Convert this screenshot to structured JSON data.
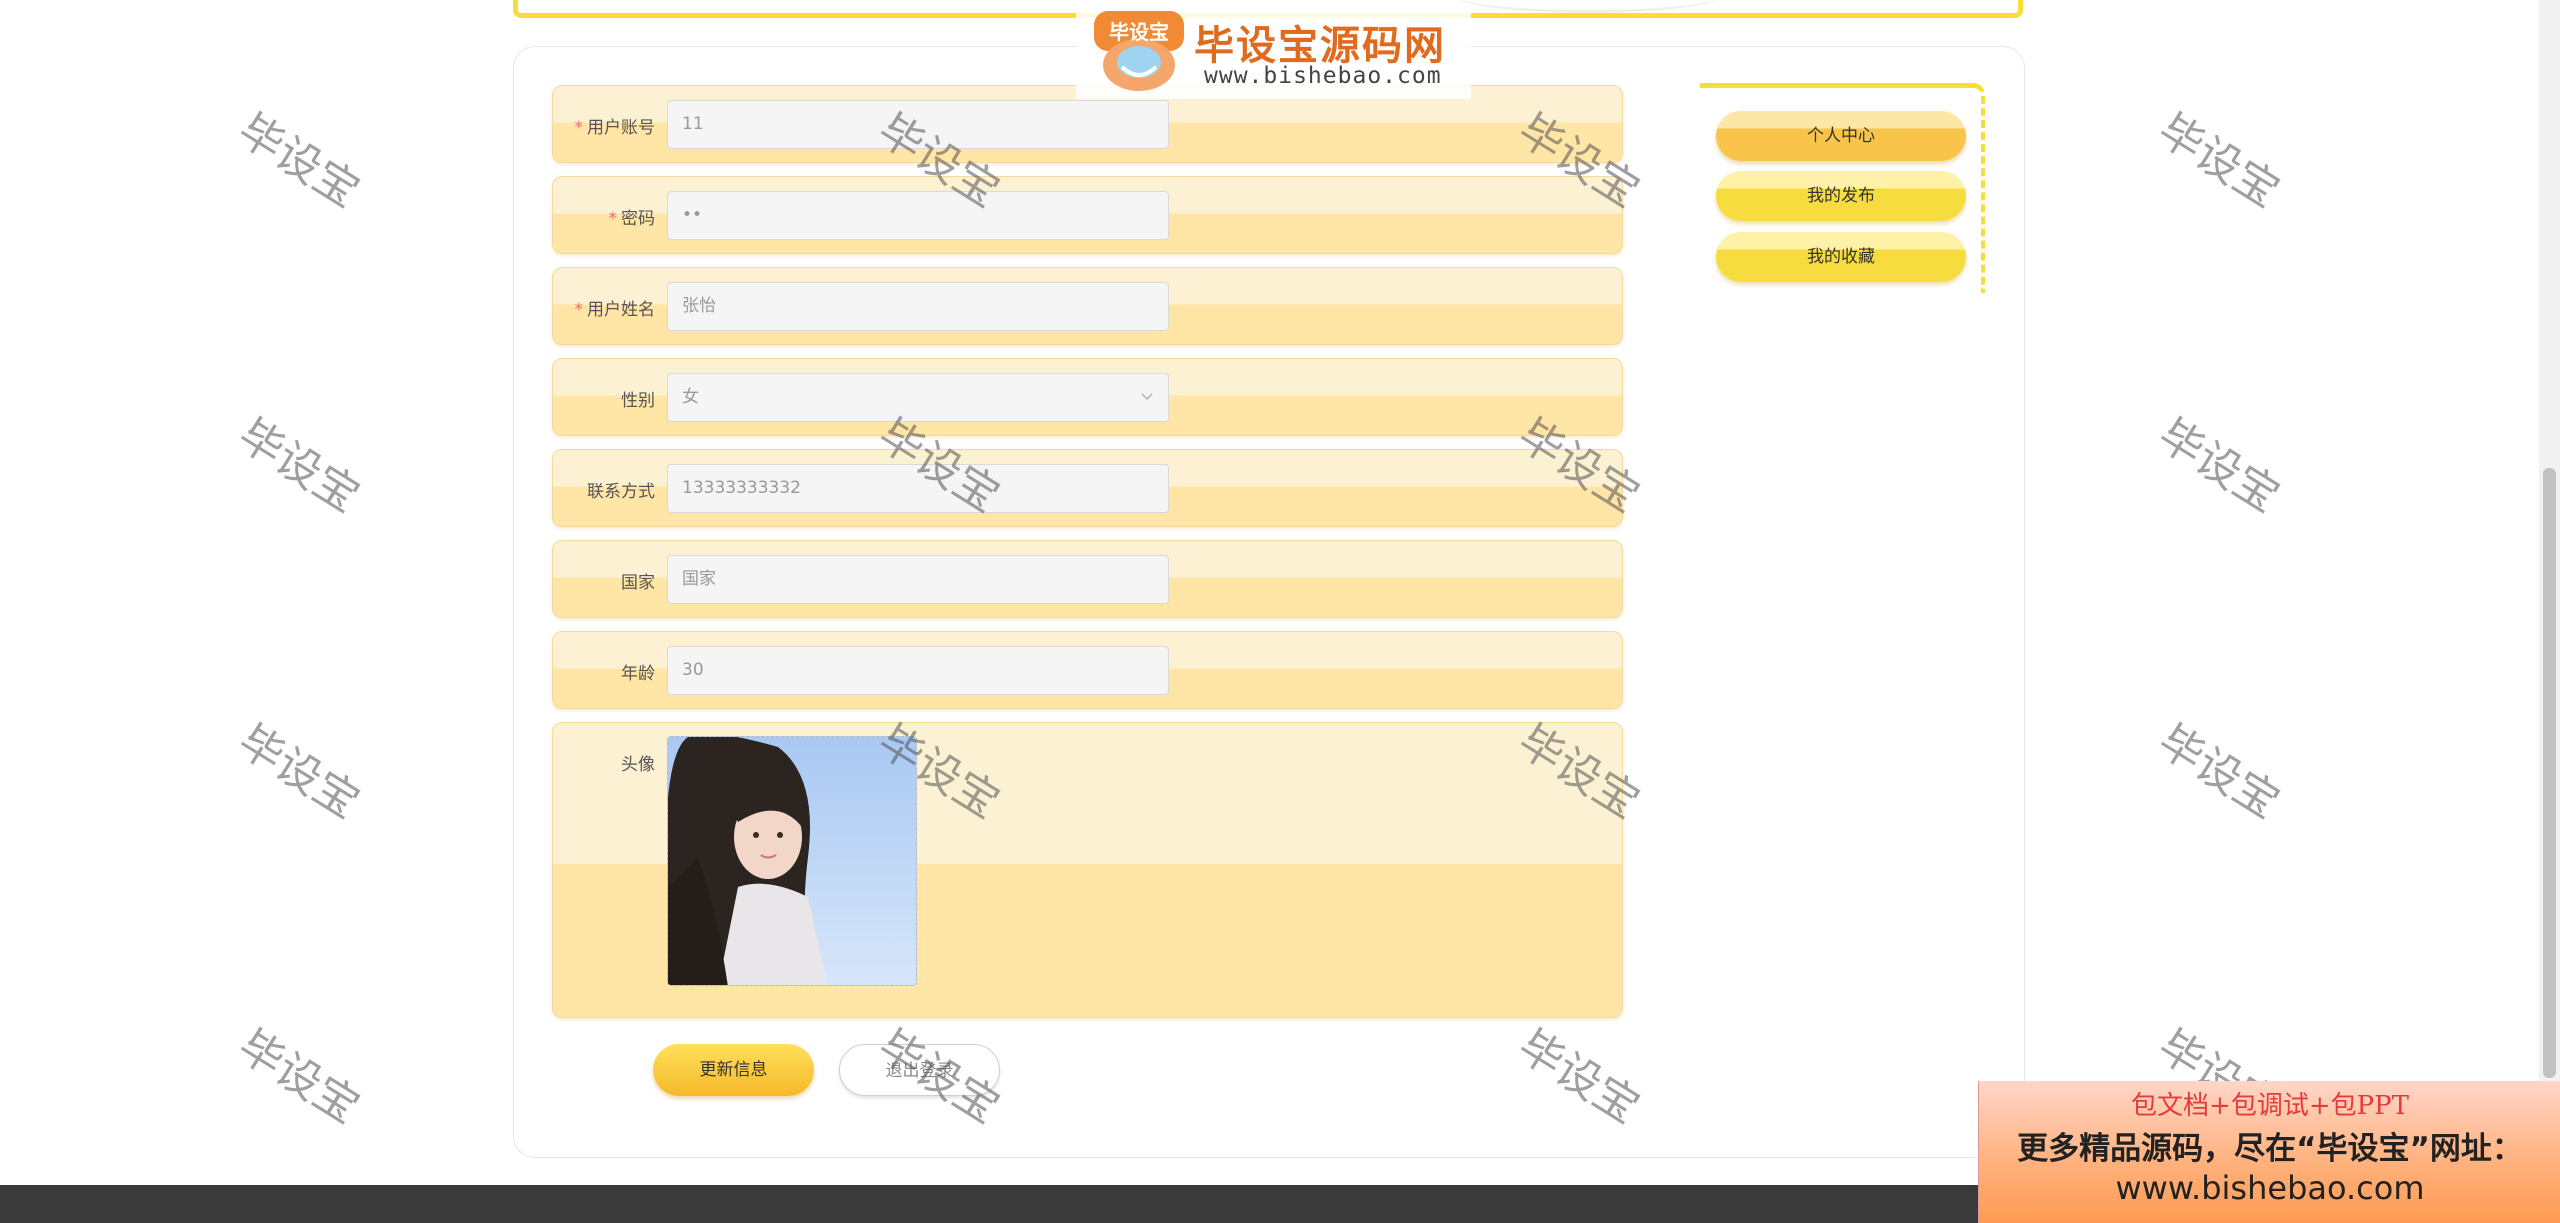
{
  "logo": {
    "title": "毕设宝源码网",
    "url": "www.bishebao.com",
    "badge_text": "毕设宝"
  },
  "form": {
    "account": {
      "label": "用户账号",
      "required": "*",
      "value": "11"
    },
    "password": {
      "label": "密码",
      "required": "*",
      "value": "••"
    },
    "name": {
      "label": "用户姓名",
      "required": "*",
      "value": "张怡"
    },
    "gender": {
      "label": "性别",
      "value": "女"
    },
    "contact": {
      "label": "联系方式",
      "value": "13333333332"
    },
    "country": {
      "label": "国家",
      "placeholder": "国家"
    },
    "age": {
      "label": "年龄",
      "value": "30"
    },
    "avatar": {
      "label": "头像"
    }
  },
  "buttons": {
    "update": "更新信息",
    "logout": "退出登录"
  },
  "side_nav": {
    "items": [
      {
        "label": "个人中心",
        "active": true
      },
      {
        "label": "我的发布",
        "active": false
      },
      {
        "label": "我的收藏",
        "active": false
      }
    ]
  },
  "watermark": "毕设宝",
  "ad": {
    "line1": "包文档+包调试+包PPT",
    "line2": "更多精品源码，尽在“毕设宝”网址：",
    "line3": "www.bishebao.com"
  },
  "colors": {
    "accent": "#f7dd3a",
    "row_bg": "#ffe6a7",
    "required": "#f56c6c",
    "footer": "#3a3a3a"
  }
}
